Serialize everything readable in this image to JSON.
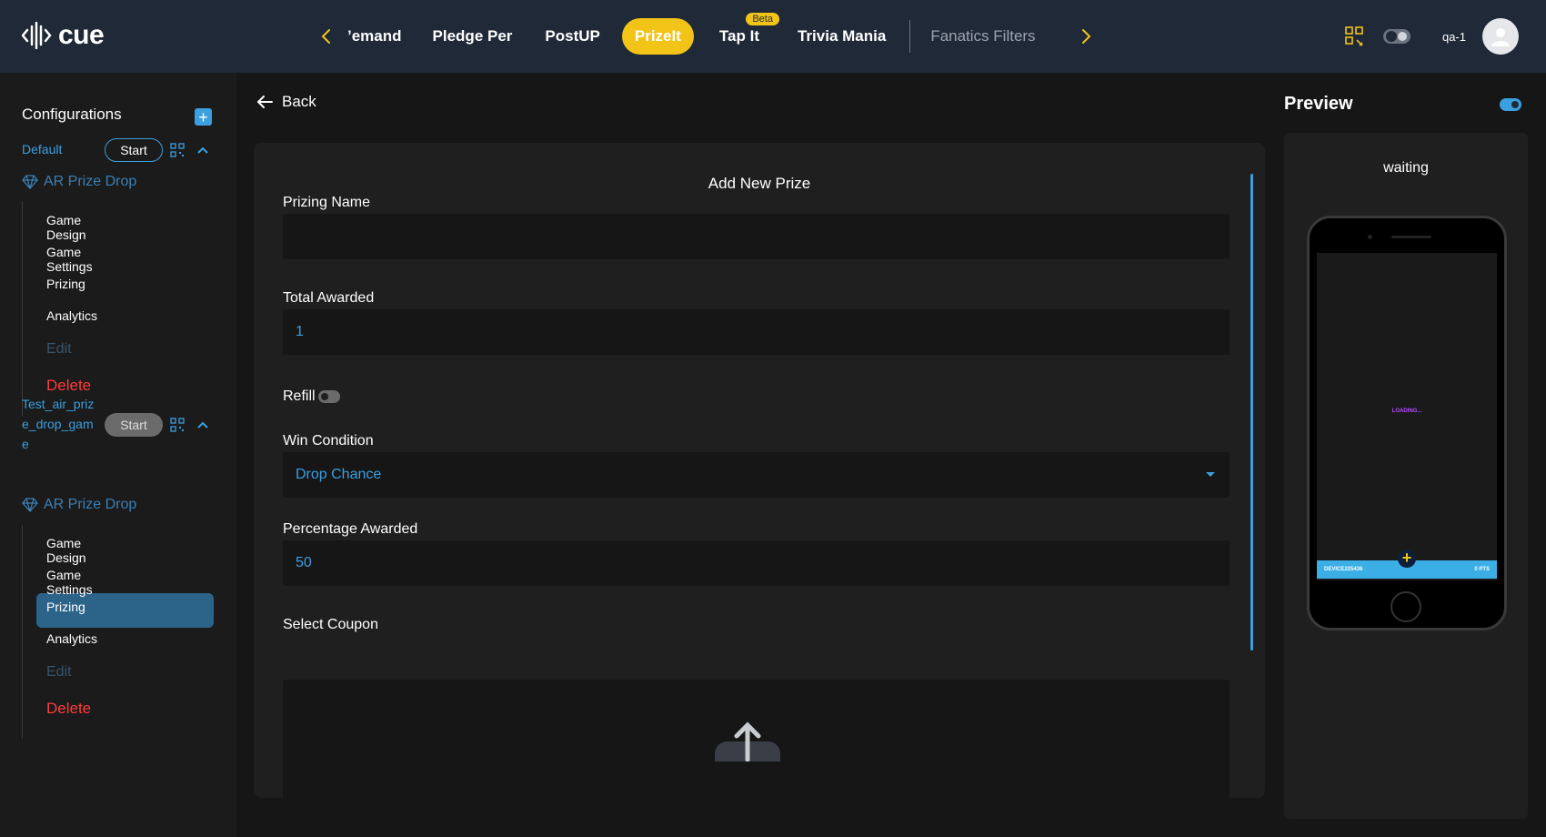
{
  "app": {
    "logo_text": "cue",
    "user": "qa-1"
  },
  "nav": {
    "tabs": [
      {
        "label": "’emand"
      },
      {
        "label": "Pledge Per"
      },
      {
        "label": "PostUP"
      },
      {
        "label": "PrizeIt"
      },
      {
        "label": "Tap It",
        "badge": "Beta"
      },
      {
        "label": "Trivia Mania"
      },
      {
        "label": "Fanatics Filters"
      }
    ],
    "active_tab": "PrizeIt"
  },
  "sidebar": {
    "title": "Configurations",
    "configs": [
      {
        "name": "Default",
        "start_label": "Start",
        "game_type": "AR Prize Drop",
        "items": [
          "Game Design",
          "Game Settings",
          "Prizing",
          "Analytics"
        ],
        "edit_label": "Edit",
        "delete_label": "Delete"
      },
      {
        "name_lines": [
          "Test_air_priz",
          "e_drop_gam",
          "e"
        ],
        "start_label": "Start",
        "game_type": "AR Prize Drop",
        "items": [
          "Game Design",
          "Game Settings",
          "Prizing",
          "Analytics"
        ],
        "active_item": "Prizing",
        "edit_label": "Edit",
        "delete_label": "Delete"
      }
    ]
  },
  "main": {
    "back_label": "Back",
    "form_title": "Add New Prize",
    "fields": {
      "prizing_name": {
        "label": "Prizing Name",
        "value": ""
      },
      "total_awarded": {
        "label": "Total Awarded",
        "value": "1"
      },
      "refill": {
        "label": "Refill",
        "on": false
      },
      "win_condition": {
        "label": "Win Condition",
        "value": "Drop Chance"
      },
      "percentage_awarded": {
        "label": "Percentage Awarded",
        "value": "50"
      },
      "select_coupon": {
        "label": "Select Coupon"
      }
    }
  },
  "preview": {
    "title": "Preview",
    "enabled": true,
    "status": "waiting",
    "screen_loading": "LOADING...",
    "bar_left": "DEVICE225436",
    "bar_right": "0 PTS"
  },
  "colors": {
    "accent": "#3b9fe0",
    "active_tab": "#f2c418",
    "delete": "#ff3b3b",
    "topbar": "#1f2937"
  }
}
